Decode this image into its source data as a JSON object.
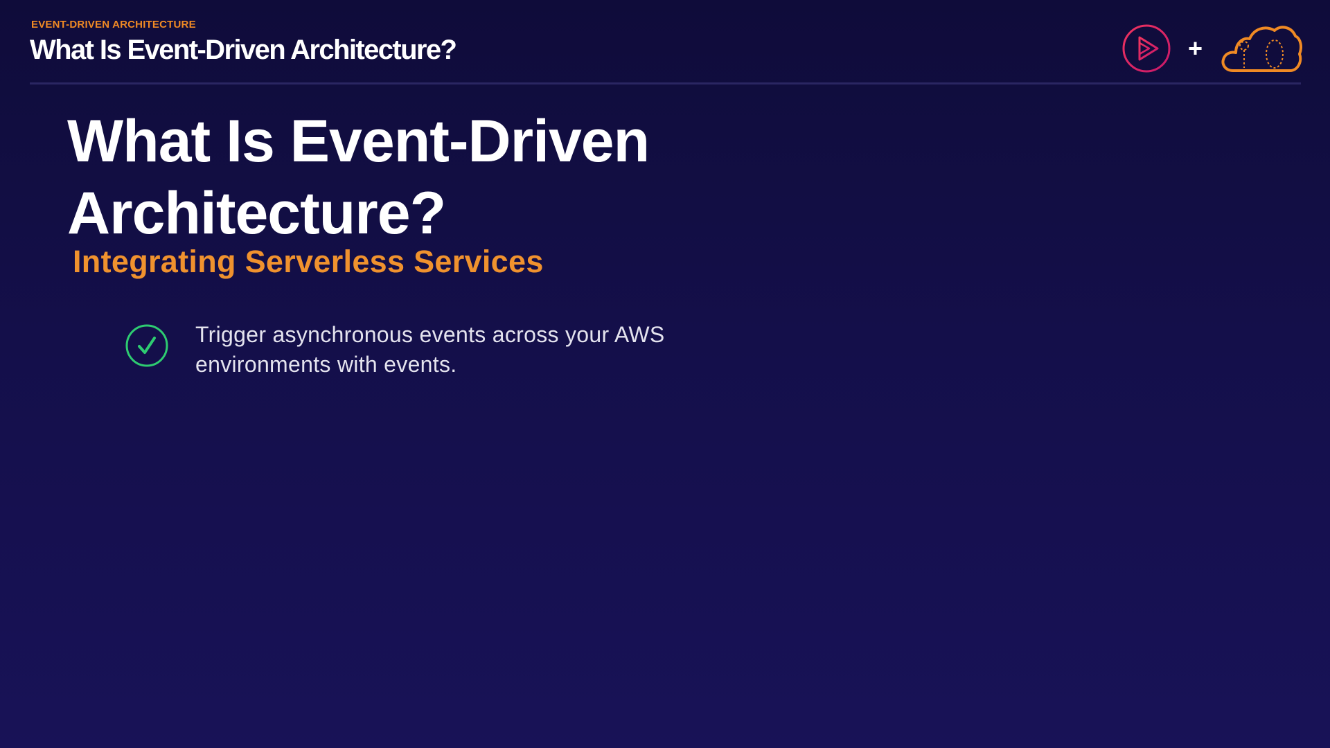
{
  "header": {
    "eyebrow": "EVENT-DRIVEN ARCHITECTURE",
    "title": "What Is Event-Driven Architecture?"
  },
  "logos": {
    "left_icon": "play-icon",
    "separator": "+",
    "right_icon": "cloud-icon"
  },
  "slide": {
    "title": "What Is Event-Driven Architecture?",
    "subtitle": "Integrating Serverless Services",
    "bullets": [
      {
        "icon": "checkmark-icon",
        "text": "Trigger asynchronous events across your AWS environments with events."
      }
    ]
  },
  "colors": {
    "accent_orange": "#f08a24",
    "check_green": "#2ecc71",
    "logo_pink": "#e8245f",
    "background": "#140f4a"
  }
}
